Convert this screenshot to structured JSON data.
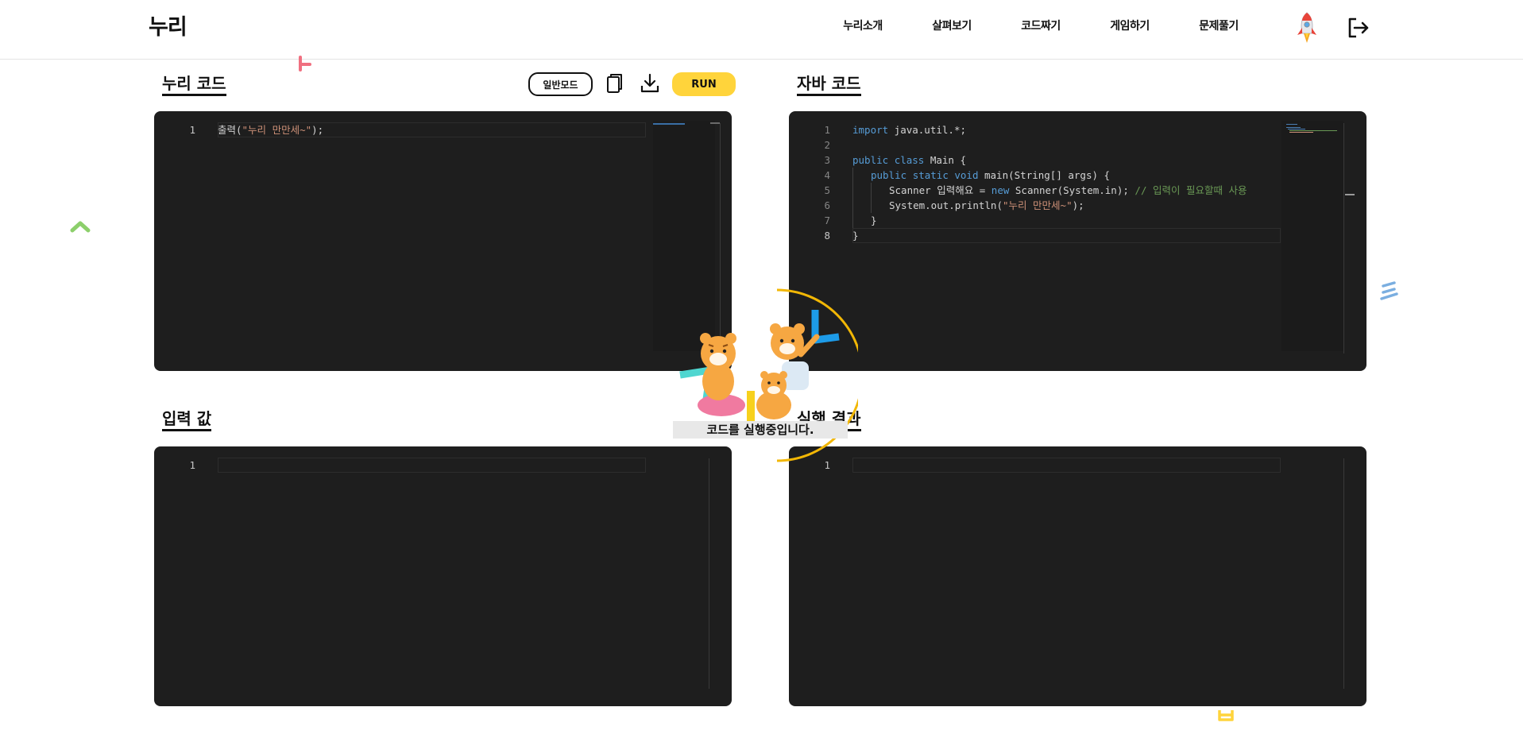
{
  "header": {
    "logo": "누리",
    "nav": [
      "누리소개",
      "살펴보기",
      "코드짜기",
      "게임하기",
      "문제풀기"
    ],
    "icons": [
      "rocket-icon",
      "logout-icon"
    ]
  },
  "nuri_panel": {
    "title": "누리 코드",
    "mode_button": "일반모드",
    "run_button": "RUN",
    "lines": [
      {
        "num": "1",
        "text": "출력(\"누리 만만세~\");"
      }
    ]
  },
  "java_panel": {
    "title": "자바 코드",
    "line_numbers": [
      "1",
      "2",
      "3",
      "4",
      "5",
      "6",
      "7",
      "8"
    ],
    "lines": [
      "import java.util.*;",
      "",
      "public class Main {",
      "public static void main(String[] args) {",
      "Scanner 입력해요 = new Scanner(System.in); // 입력이 필요할때 사용",
      "System.out.println(\"누리 만만세~\");",
      "}",
      "}"
    ]
  },
  "input_panel": {
    "title": "입력 값",
    "line_number": "1"
  },
  "output_panel": {
    "title": "실행 결과",
    "line_number": "1"
  },
  "loading": {
    "message": "코드를 실행중입니다."
  },
  "colors": {
    "run_accent": "#ffd43b",
    "editor_bg": "#1e1e1e",
    "keyword": "#569cd6",
    "string": "#ce9178",
    "comment": "#6a9955"
  }
}
